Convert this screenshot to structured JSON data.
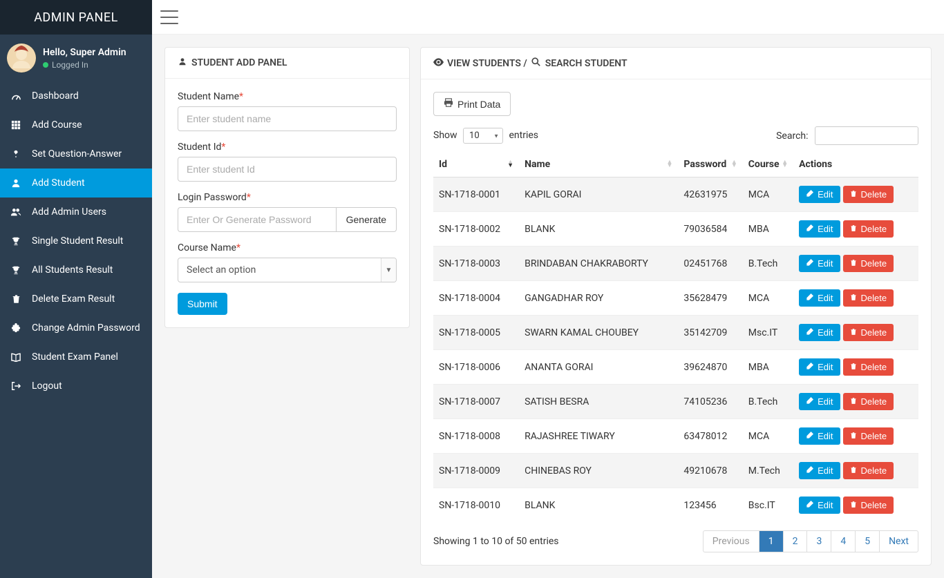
{
  "brand": "ADMIN PANEL",
  "user": {
    "greeting": "Hello, Super Admin",
    "status": "Logged In"
  },
  "nav": [
    {
      "label": "Dashboard",
      "icon": "tachometer"
    },
    {
      "label": "Add Course",
      "icon": "grid"
    },
    {
      "label": "Set Question-Answer",
      "icon": "question"
    },
    {
      "label": "Add Student",
      "icon": "user",
      "active": true
    },
    {
      "label": "Add Admin Users",
      "icon": "users"
    },
    {
      "label": "Single Student Result",
      "icon": "trophy"
    },
    {
      "label": "All Students Result",
      "icon": "trophy"
    },
    {
      "label": "Delete Exam Result",
      "icon": "trash"
    },
    {
      "label": "Change Admin Password",
      "icon": "puzzle"
    },
    {
      "label": "Student Exam Panel",
      "icon": "book"
    },
    {
      "label": "Logout",
      "icon": "logout"
    }
  ],
  "addPanel": {
    "title": "STUDENT ADD PANEL",
    "fields": {
      "studentName": {
        "label": "Student Name",
        "placeholder": "Enter student name"
      },
      "studentId": {
        "label": "Student Id",
        "placeholder": "Enter student Id"
      },
      "loginPassword": {
        "label": "Login Password",
        "placeholder": "Enter Or Generate Password",
        "generate": "Generate"
      },
      "courseName": {
        "label": "Course Name",
        "option": "Select an option"
      }
    },
    "submit": "Submit"
  },
  "viewPanel": {
    "titleView": "VIEW STUDENTS /",
    "titleSearch": "SEARCH STUDENT",
    "printBtn": "Print Data",
    "showLabel": "Show",
    "entriesLabel": "entries",
    "entriesValue": "10",
    "searchLabel": "Search:",
    "columns": {
      "id": "Id",
      "name": "Name",
      "password": "Password",
      "course": "Course",
      "actions": "Actions"
    },
    "editLabel": "Edit",
    "deleteLabel": "Delete",
    "rows": [
      {
        "id": "SN-1718-0001",
        "name": "KAPIL GORAI",
        "password": "42631975",
        "course": "MCA"
      },
      {
        "id": "SN-1718-0002",
        "name": "BLANK",
        "password": "79036584",
        "course": "MBA"
      },
      {
        "id": "SN-1718-0003",
        "name": "BRINDABAN CHAKRABORTY",
        "password": "02451768",
        "course": "B.Tech"
      },
      {
        "id": "SN-1718-0004",
        "name": "GANGADHAR ROY",
        "password": "35628479",
        "course": "MCA"
      },
      {
        "id": "SN-1718-0005",
        "name": "SWARN KAMAL CHOUBEY",
        "password": "35142709",
        "course": "Msc.IT"
      },
      {
        "id": "SN-1718-0006",
        "name": "ANANTA GORAI",
        "password": "39624870",
        "course": "MBA"
      },
      {
        "id": "SN-1718-0007",
        "name": "SATISH BESRA",
        "password": "74105236",
        "course": "B.Tech"
      },
      {
        "id": "SN-1718-0008",
        "name": "RAJASHREE TIWARY",
        "password": "63478012",
        "course": "MCA"
      },
      {
        "id": "SN-1718-0009",
        "name": "CHINEBAS ROY",
        "password": "49210678",
        "course": "M.Tech"
      },
      {
        "id": "SN-1718-0010",
        "name": "BLANK",
        "password": "123456",
        "course": "Bsc.IT"
      }
    ],
    "footerInfo": "Showing 1 to 10 of 50 entries",
    "pagination": {
      "prev": "Previous",
      "pages": [
        "1",
        "2",
        "3",
        "4",
        "5"
      ],
      "next": "Next",
      "active": "1"
    }
  }
}
